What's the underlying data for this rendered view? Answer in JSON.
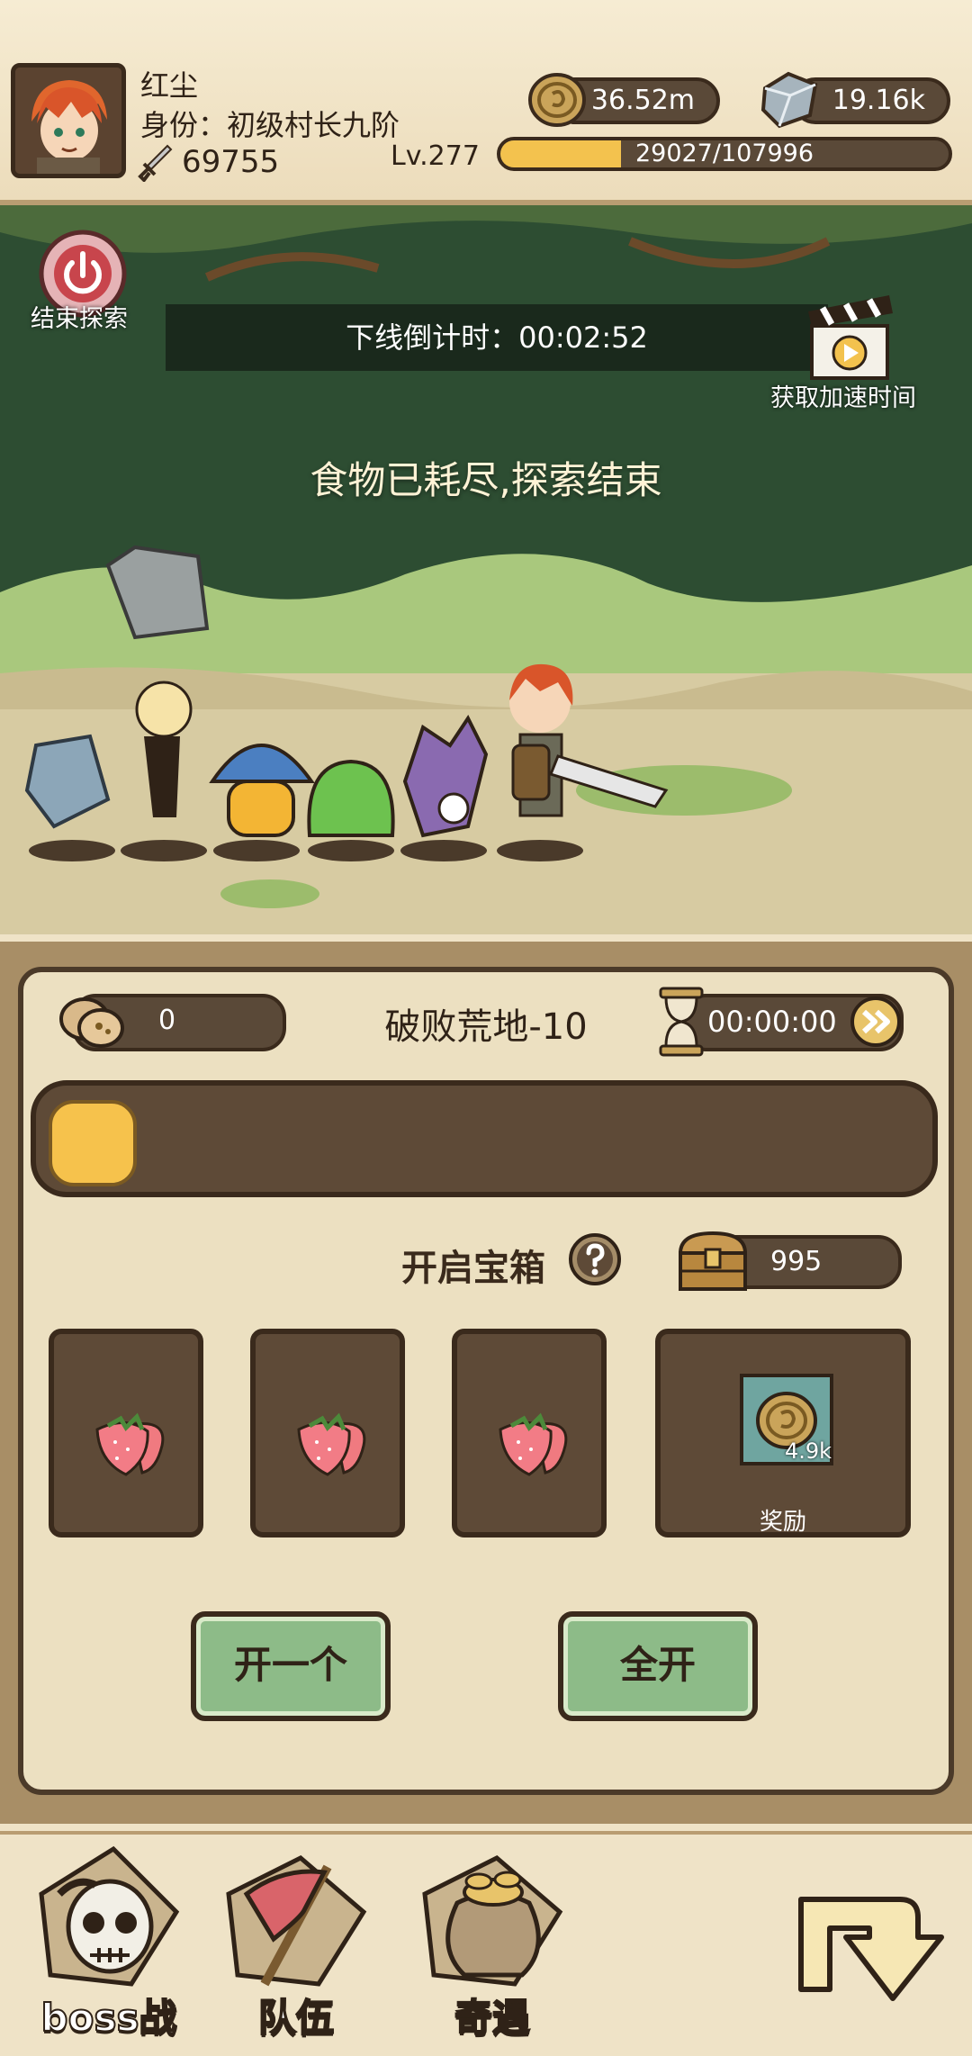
{
  "header": {
    "player_name": "红尘",
    "rank": "身份：初级村长九阶",
    "power": "69755",
    "level": "Lv.277",
    "xp_text": "29027/107996",
    "xp_fraction": 0.269,
    "gold": "36.52m",
    "gems": "19.16k",
    "icons": {
      "avatar": "avatar-portrait",
      "power": "sword-icon",
      "gold": "gold-coin-icon",
      "gems": "gem-icon"
    }
  },
  "scene": {
    "end_label": "结束探索",
    "countdown": "下线倒计时：00:02:52",
    "speedup_label": "获取加速时间",
    "message": "食物已耗尽,探索结束",
    "icons": {
      "end": "power-icon",
      "speedup": "clapperboard-icon"
    }
  },
  "panel": {
    "food_count": "0",
    "stage_name": "破败荒地-10",
    "timer": "00:00:00",
    "open_chest_label": "开启宝箱",
    "chest_count": "995",
    "reward_amount": "4.9k",
    "reward_label": "奖励",
    "open_one": "开一个",
    "open_all": "全开",
    "slot_items": [
      "strawberry-icon",
      "strawberry-icon",
      "strawberry-icon"
    ],
    "icons": {
      "food": "cookie-icon",
      "timer": "hourglass-icon",
      "fast_forward": "fast-forward-icon",
      "help": "question-icon",
      "chest": "treasure-chest-icon"
    }
  },
  "nav": {
    "boss": "boss战",
    "team": "队伍",
    "encounter": "奇遇",
    "icons": {
      "boss": "skull-icon",
      "team": "flag-icon",
      "encounter": "money-bag-icon",
      "back": "return-arrow-icon"
    }
  },
  "colors": {
    "accent": "#f3c24e",
    "panel": "#ece0c1",
    "dark": "#5e4a37",
    "button": "#8dbb88",
    "forest": "#2d4d32"
  }
}
